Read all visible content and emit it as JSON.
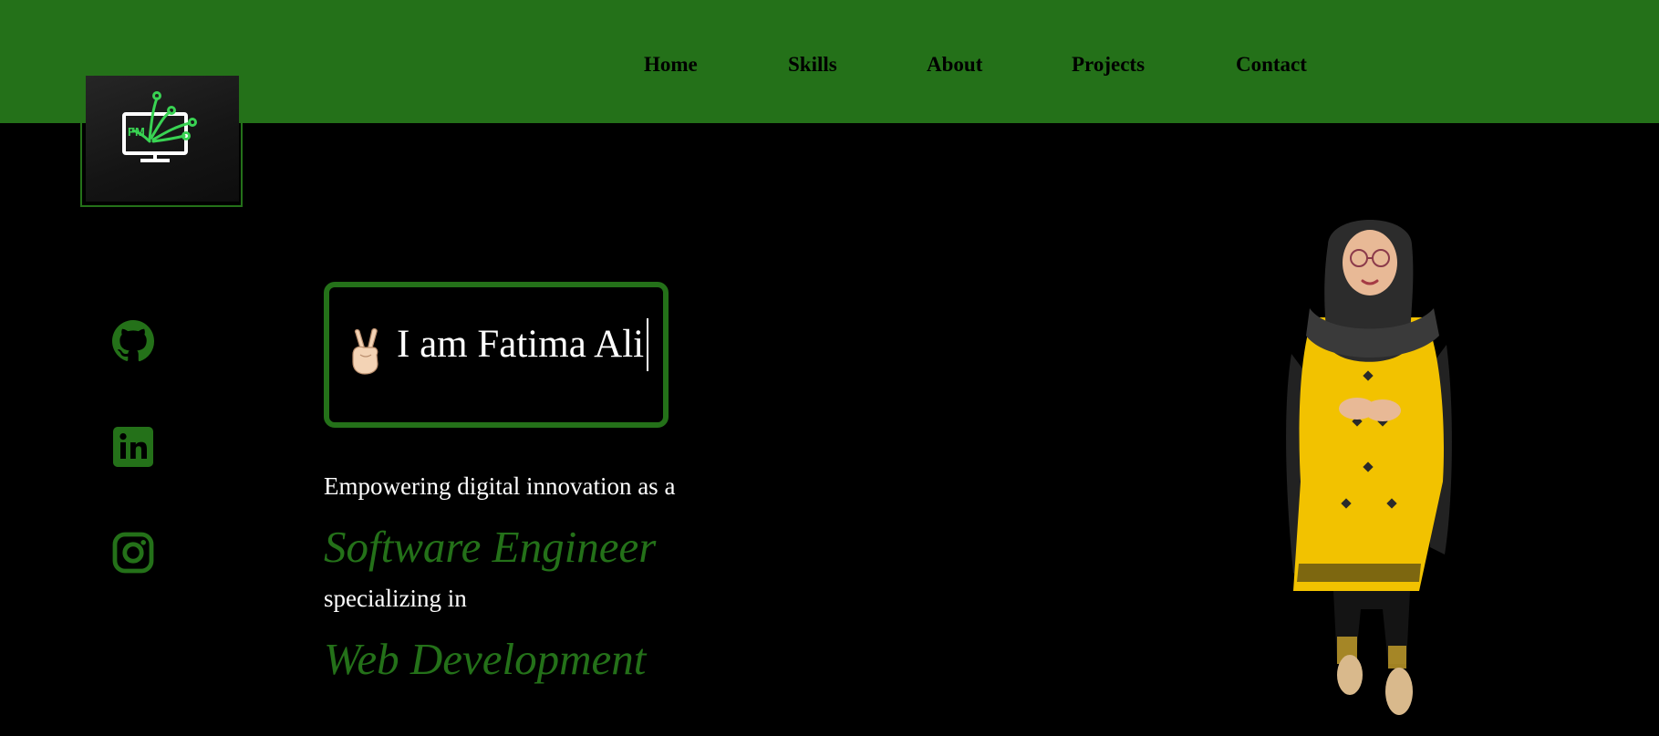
{
  "nav": {
    "items": [
      {
        "label": "Home"
      },
      {
        "label": "Skills"
      },
      {
        "label": "About"
      },
      {
        "label": "Projects"
      },
      {
        "label": "Contact"
      }
    ]
  },
  "logo": {
    "text": "FM",
    "accent_color": "#39d353"
  },
  "social": [
    {
      "icon": "github-icon"
    },
    {
      "icon": "linkedin-icon"
    },
    {
      "icon": "instagram-icon"
    }
  ],
  "hero": {
    "greeting_emoji": "victory-hand-icon",
    "greeting": "I am Fatima Ali",
    "line1": "Empowering digital innovation as a",
    "role1": "Software Engineer",
    "line2": "specializing in",
    "role2": "Web Development"
  },
  "colors": {
    "accent": "#247119",
    "background": "#000000",
    "text": "#ffffff"
  }
}
